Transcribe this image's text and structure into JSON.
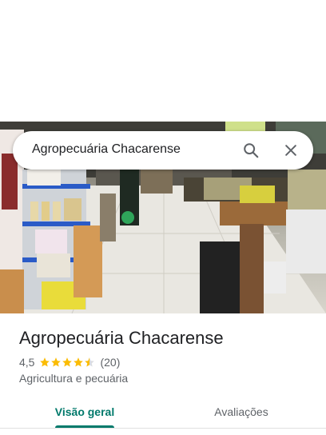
{
  "search": {
    "query": "Agropecuária Chacarense"
  },
  "place": {
    "name": "Agropecuária Chacarense",
    "rating": "4,5",
    "rating_value": 4.5,
    "review_count": "(20)",
    "category": "Agricultura e pecuária"
  },
  "tabs": [
    {
      "label": "Visão geral",
      "active": true
    },
    {
      "label": "Avaliações",
      "active": false
    }
  ],
  "colors": {
    "accent": "#00796b",
    "star": "#fbbc04"
  },
  "icons": {
    "search": "search-icon",
    "close": "close-icon",
    "star": "star-icon"
  }
}
